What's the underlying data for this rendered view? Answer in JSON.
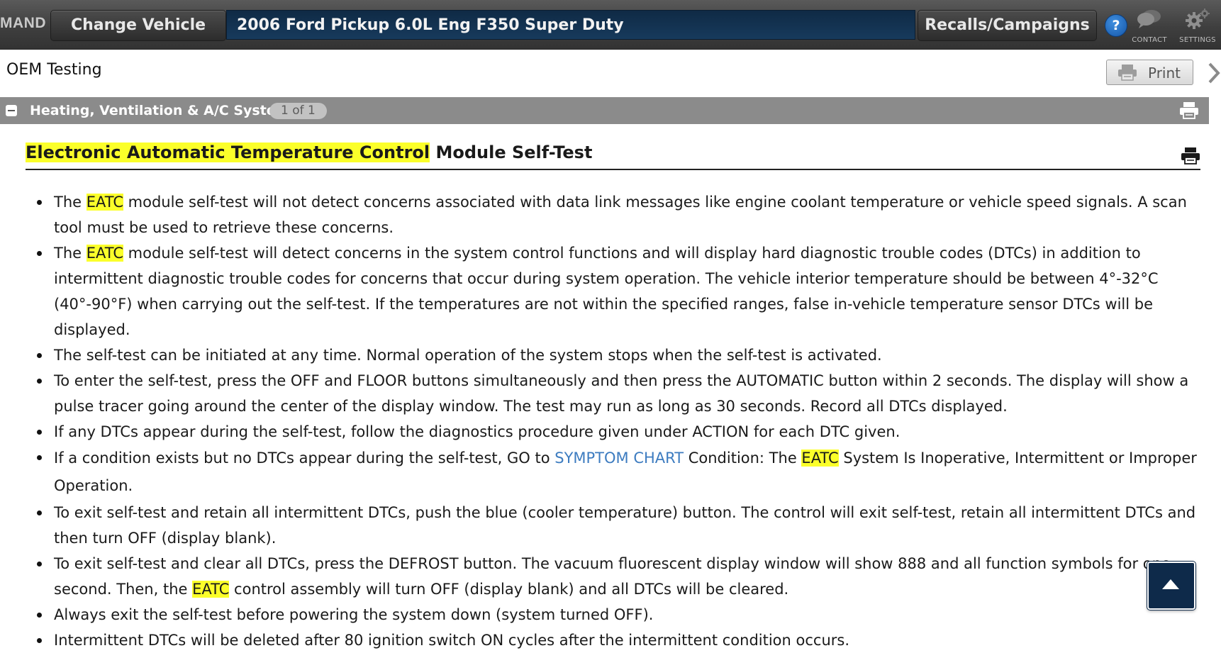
{
  "topbar": {
    "brand": "MAND",
    "change_vehicle_label": "Change Vehicle",
    "vehicle": "2006 Ford Pickup 6.0L Eng F350 Super Duty",
    "recalls_label": "Recalls/Campaigns",
    "help_label": "?",
    "contact_label": "CONTACT",
    "settings_label": "SETTINGS"
  },
  "toolbar": {
    "page_heading": "OEM Testing",
    "print_label": "Print"
  },
  "section": {
    "title": "Heating, Ventilation & A/C System",
    "count": "1 of 1"
  },
  "document": {
    "title_highlighted": "Electronic Automatic Temperature Control",
    "title_rest": " Module Self-Test",
    "highlight_term": "EATC",
    "bullets": [
      {
        "pre": "The ",
        "post": " module self-test will not detect concerns associated with data link messages like engine coolant temperature or vehicle speed signals. A scan tool must be used to retrieve these concerns."
      },
      {
        "pre": "The ",
        "post": " module self-test will detect concerns in the system control functions and will display hard diagnostic trouble codes (DTCs) in addition to intermittent diagnostic trouble codes for concerns that occur during system operation. The vehicle interior temperature should be between 4°-32°C (40°-90°F) when carrying out the self-test. If the temperatures are not within the specified ranges, false in-vehicle temperature sensor DTCs will be displayed."
      },
      {
        "text": "The self-test can be initiated at any time. Normal operation of the system stops when the self-test is activated."
      },
      {
        "text": "To enter the self-test, press the OFF and FLOOR buttons simultaneously and then press the AUTOMATIC button within 2 seconds. The display will show a pulse tracer going around the center of the display window. The test may run as long as 30 seconds. Record all DTCs displayed."
      },
      {
        "text": "If any DTCs appear during the self-test, follow the diagnostics procedure given under ACTION for each DTC given."
      },
      {
        "pre": "If a condition exists but no DTCs appear during the self-test, GO to ",
        "link": "SYMPTOM CHART",
        "mid": " Condition: The ",
        "post": " System Is Inoperative, Intermittent or Improper Operation."
      },
      {
        "text": "To exit self-test and retain all intermittent DTCs, push the blue (cooler temperature) button. The control will exit self-test, retain all intermittent DTCs and then turn OFF (display blank)."
      },
      {
        "pre": "To exit self-test and clear all DTCs, press the DEFROST button. The vacuum fluorescent display window will show 888 and all function symbols for one second. Then, the ",
        "post": " control assembly will turn OFF (display blank) and all DTCs will be cleared."
      },
      {
        "text": "Always exit the self-test before powering the system down (system turned OFF)."
      },
      {
        "text": "Intermittent DTCs will be deleted after 80 ignition switch ON cycles after the intermittent condition occurs."
      }
    ]
  },
  "colors": {
    "highlight": "#fbff2a",
    "link": "#3d7cc0",
    "vehicle_field": "#173a5c",
    "section_bar": "#8b8b8b"
  }
}
